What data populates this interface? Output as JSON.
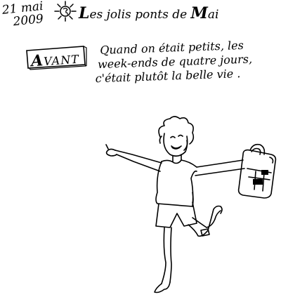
{
  "header": {
    "date_line1": "21 mai",
    "date_line2": "2009",
    "title_first": "L",
    "title_rest": "es jolis ponts de ",
    "title_last_cap": "M",
    "title_last_rest": "ai"
  },
  "panel": {
    "label_cap": "A",
    "label_rest": "VANT",
    "text_line1": "Quand on était petits, les",
    "text_line2": "week-ends de quatre jours,",
    "text_line3": "c'était plutôt  la belle vie ."
  },
  "icons": [
    "sun-icon",
    "child-figure-icon",
    "schoolbag-icon"
  ]
}
